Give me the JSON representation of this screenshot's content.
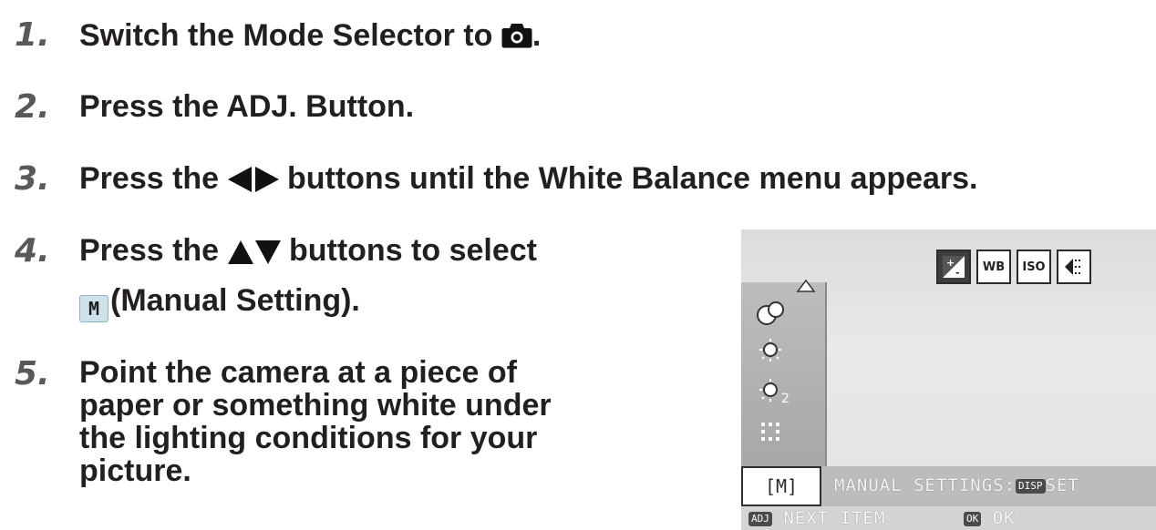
{
  "steps": [
    {
      "num": "1.",
      "text": "Switch the Mode Selector to ",
      "text_after": "."
    },
    {
      "num": "2.",
      "text": "Press the ADJ. Button."
    },
    {
      "num": "3.",
      "text": "Press the ",
      "text_after": " buttons until the White Balance menu appears."
    },
    {
      "num": "4.",
      "text": "Press the ",
      "text_after": " buttons to select",
      "line2_icon": "M",
      "line2": "(Manual Setting)."
    },
    {
      "num": "5.",
      "lines": [
        "Point the camera at a piece of",
        "paper or something white under",
        "the lighting conditions for your",
        "picture."
      ]
    }
  ],
  "icons": {
    "step1": "camera-icon",
    "step3": "left-right-arrows-icon",
    "step4": "up-down-arrows-icon"
  },
  "lcd": {
    "top_icons": [
      "exposure-comp-icon",
      "WB",
      "ISO",
      "focus-icon"
    ],
    "wb_label": "WB",
    "iso_label": "ISO",
    "menu_items": [
      "auto-icon",
      "daylight-icon",
      "daylight-2-icon",
      "fluorescent-icon"
    ],
    "selected": "[M]",
    "setting_text": "MANUAL SETTINGS:",
    "disp_label": "DISP",
    "set_label": "SET",
    "adj_label": "ADJ",
    "next_item": "NEXT ITEM",
    "ok_label": "OK",
    "ok_text": "OK"
  }
}
